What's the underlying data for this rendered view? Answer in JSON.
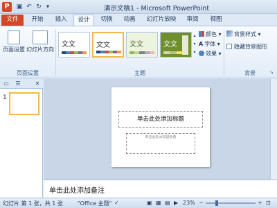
{
  "window": {
    "title": "演示文稿1 - Microsoft PowerPoint",
    "app_icon_letter": "P"
  },
  "quick_access": {
    "save_icon": "save-icon",
    "undo_icon": "undo-icon",
    "redo_icon": "redo-icon",
    "customize_icon": "chevron-down-icon"
  },
  "tabs": [
    {
      "label": "文件"
    },
    {
      "label": "开始"
    },
    {
      "label": "插入"
    },
    {
      "label": "设计"
    },
    {
      "label": "切换"
    },
    {
      "label": "动画"
    },
    {
      "label": "幻灯片放映"
    },
    {
      "label": "审阅"
    },
    {
      "label": "视图"
    }
  ],
  "ribbon": {
    "page_setup": {
      "page_setup_label": "页面设置",
      "orientation_label": "幻灯片方向",
      "group_label": "页面设置"
    },
    "themes": {
      "items": [
        {
          "text": "文文",
          "selected": false
        },
        {
          "text": "文文",
          "selected": true
        },
        {
          "text": "文文",
          "selected": false
        },
        {
          "text": "文文",
          "selected": false
        }
      ],
      "colors_label": "颜色",
      "fonts_label": "字体",
      "effects_label": "效果",
      "group_label": "主题"
    },
    "background": {
      "styles_label": "背景样式",
      "hide_graphics_label": "隐藏背景图形",
      "group_label": "背景"
    }
  },
  "slide_pane": {
    "slide_number": "1"
  },
  "slide": {
    "title_placeholder": "单击此处添加标题",
    "subtitle_placeholder": "单击此处添加副标题"
  },
  "notes": {
    "placeholder": "单击此处添加备注"
  },
  "status_bar": {
    "slide_info": "幻灯片 第 1 张，共 1 张",
    "theme_name": "\"Office 主题\"",
    "zoom": "23%"
  },
  "colors": {
    "accent": "#d24726",
    "selected_border": "#f0b94a"
  }
}
